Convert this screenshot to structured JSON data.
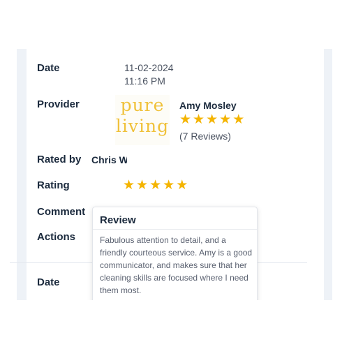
{
  "record": {
    "date_label": "Date",
    "date": "11-02-2024",
    "time": "11:16 PM",
    "provider_label": "Provider",
    "provider_logo_lines": [
      "pure",
      "living"
    ],
    "provider_name": "Amy Mosley",
    "provider_stars": 5,
    "provider_reviews": "(7 Reviews)",
    "rated_by_label": "Rated by",
    "rated_by": "Chris W",
    "rating_label": "Rating",
    "rating_stars": 5,
    "comment_label": "Comment",
    "actions_label": "Actions"
  },
  "tooltip": {
    "title": "Review",
    "text": "Fabulous attention to detail, and a friendly courteous service. Amy is a good communicator, and makes sure that her cleaning skills are focused where I need them most."
  },
  "next_record": {
    "date_label": "Date"
  },
  "colors": {
    "star": "#f4b400",
    "logo": "#f0c13a",
    "heading": "#1b2a3d",
    "background_strip": "#eef2f7"
  },
  "icons": {
    "star": "star-icon"
  }
}
